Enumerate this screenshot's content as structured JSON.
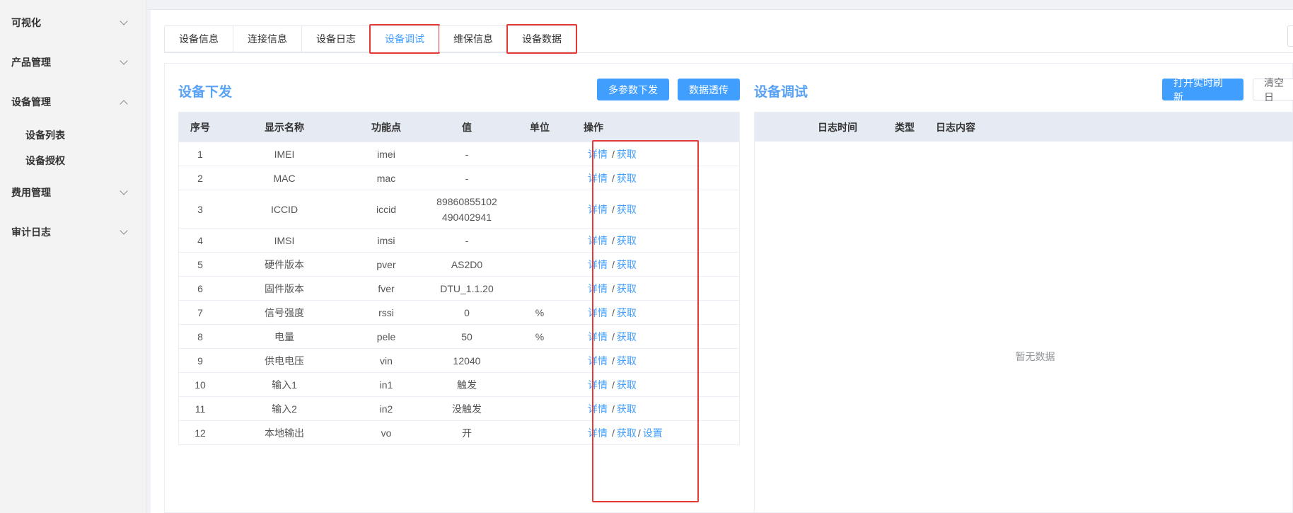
{
  "sidebar": {
    "menus": [
      {
        "label": "可视化",
        "expanded": false
      },
      {
        "label": "产品管理",
        "expanded": false
      },
      {
        "label": "设备管理",
        "expanded": true
      },
      {
        "label": "费用管理",
        "expanded": false
      },
      {
        "label": "审计日志",
        "expanded": false
      }
    ],
    "submenus": [
      "设备列表",
      "设备授权"
    ]
  },
  "tabs": [
    "设备信息",
    "连接信息",
    "设备日志",
    "设备调试",
    "维保信息",
    "设备数据"
  ],
  "active_tab": "设备调试",
  "highlighted_tabs": [
    "设备调试",
    "设备数据"
  ],
  "left_panel": {
    "title": "设备下发",
    "buttons": {
      "multi": "多参数下发",
      "passthrough": "数据透传"
    },
    "columns": [
      "序号",
      "显示名称",
      "功能点",
      "值",
      "单位",
      "操作"
    ],
    "rows": [
      {
        "no": "1",
        "name": "IMEI",
        "key": "imei",
        "value": "-",
        "unit": "",
        "ops": [
          "详情",
          "获取"
        ]
      },
      {
        "no": "2",
        "name": "MAC",
        "key": "mac",
        "value": "-",
        "unit": "",
        "ops": [
          "详情",
          "获取"
        ]
      },
      {
        "no": "3",
        "name": "ICCID",
        "key": "iccid",
        "value": "89860855102 490402941",
        "unit": "",
        "ops": [
          "详情",
          "获取"
        ]
      },
      {
        "no": "4",
        "name": "IMSI",
        "key": "imsi",
        "value": "-",
        "unit": "",
        "ops": [
          "详情",
          "获取"
        ]
      },
      {
        "no": "5",
        "name": "硬件版本",
        "key": "pver",
        "value": "AS2D0",
        "unit": "",
        "ops": [
          "详情",
          "获取"
        ]
      },
      {
        "no": "6",
        "name": "固件版本",
        "key": "fver",
        "value": "DTU_1.1.20",
        "unit": "",
        "ops": [
          "详情",
          "获取"
        ]
      },
      {
        "no": "7",
        "name": "信号强度",
        "key": "rssi",
        "value": "0",
        "unit": "%",
        "ops": [
          "详情",
          "获取"
        ]
      },
      {
        "no": "8",
        "name": "电量",
        "key": "pele",
        "value": "50",
        "unit": "%",
        "ops": [
          "详情",
          "获取"
        ]
      },
      {
        "no": "9",
        "name": "供电电压",
        "key": "vin",
        "value": "12040",
        "unit": "",
        "ops": [
          "详情",
          "获取"
        ]
      },
      {
        "no": "10",
        "name": "输入1",
        "key": "in1",
        "value": "触发",
        "unit": "",
        "ops": [
          "详情",
          "获取"
        ]
      },
      {
        "no": "11",
        "name": "输入2",
        "key": "in2",
        "value": "没触发",
        "unit": "",
        "ops": [
          "详情",
          "获取"
        ]
      },
      {
        "no": "12",
        "name": "本地输出",
        "key": "vo",
        "value": "开",
        "unit": "",
        "ops": [
          "详情",
          "获取",
          "设置"
        ]
      }
    ]
  },
  "right_panel": {
    "title": "设备调试",
    "buttons": {
      "refresh": "打开实时刷新",
      "clear": "清空日"
    },
    "columns": [
      "",
      "日志时间",
      "类型",
      "日志内容"
    ],
    "empty_text": "暂无数据"
  },
  "colors": {
    "accent": "#409eff",
    "highlight": "#e53935",
    "title": "#5aa3f4"
  }
}
